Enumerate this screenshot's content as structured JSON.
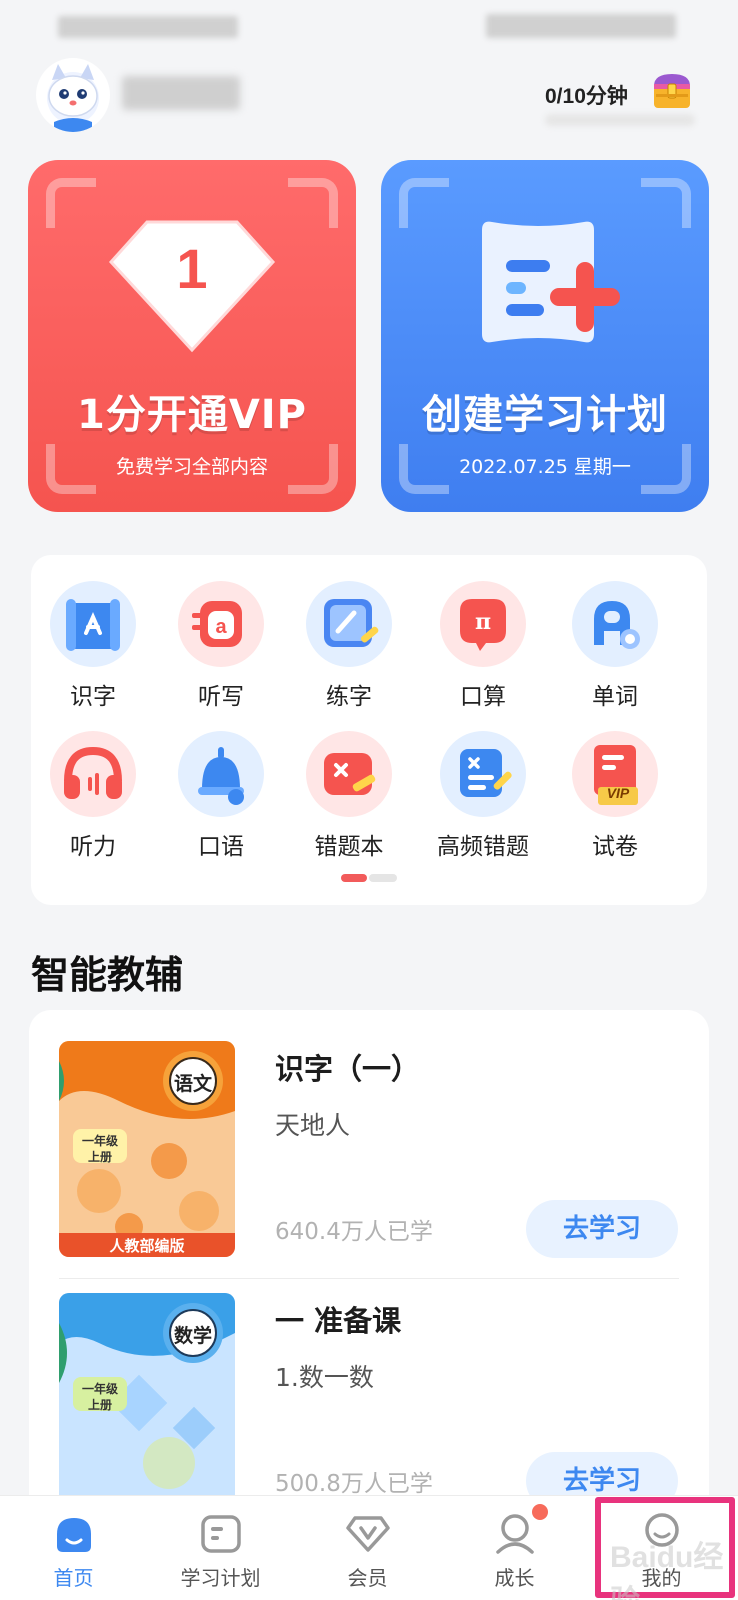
{
  "header": {
    "timer_text": "0/10分钟"
  },
  "cards": [
    {
      "title": "1分开通VIP",
      "subtitle": "免费学习全部内容",
      "badge": "1",
      "color": "#f5544f"
    },
    {
      "title": "创建学习计划",
      "subtitle": "2022.07.25 星期一",
      "color": "#3f7ef0"
    }
  ],
  "features": [
    {
      "label": "识字",
      "icon": "book-scroll-icon"
    },
    {
      "label": "听写",
      "icon": "dictation-icon"
    },
    {
      "label": "练字",
      "icon": "writing-pad-icon"
    },
    {
      "label": "口算",
      "icon": "pi-bubble-icon"
    },
    {
      "label": "单词",
      "icon": "letter-a-icon"
    },
    {
      "label": "听力",
      "icon": "headphones-icon"
    },
    {
      "label": "口语",
      "icon": "bell-icon"
    },
    {
      "label": "错题本",
      "icon": "wrong-notebook-icon"
    },
    {
      "label": "高频错题",
      "icon": "frequent-errors-icon"
    },
    {
      "label": "试卷",
      "icon": "vip-exam-icon",
      "tag": "VIP"
    }
  ],
  "section": {
    "title": "智能教辅"
  },
  "courses": [
    {
      "title": "识字（一）",
      "subtitle": "天地人",
      "count": "640.4万人已学",
      "button": "去学习",
      "subject": "语文",
      "grade_line1": "一年级",
      "grade_line2": "上册",
      "edition": "人教部编版"
    },
    {
      "title": "一 准备课",
      "subtitle": "1.数一数",
      "count": "500.8万人已学",
      "button": "去学习",
      "subject": "数学",
      "grade_line1": "一年级",
      "grade_line2": "上册"
    }
  ],
  "tabs": [
    {
      "label": "首页",
      "icon": "home-icon",
      "active": true
    },
    {
      "label": "学习计划",
      "icon": "plan-icon"
    },
    {
      "label": "会员",
      "icon": "vip-icon"
    },
    {
      "label": "成长",
      "icon": "growth-icon",
      "badge": true
    },
    {
      "label": "我的",
      "icon": "profile-icon"
    }
  ],
  "watermark": "Baidu经验"
}
